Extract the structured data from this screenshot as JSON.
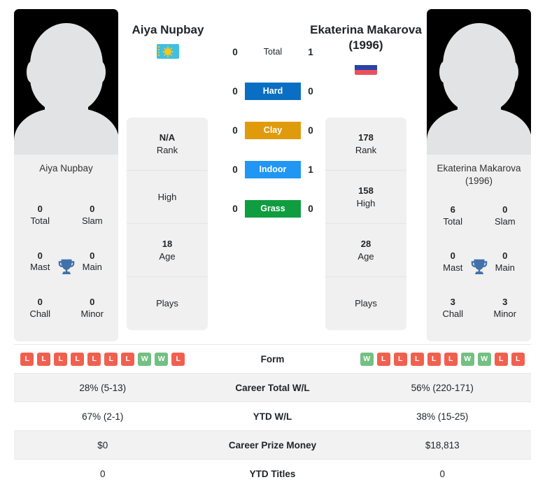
{
  "players": {
    "left": {
      "name": "Aiya Nupbay",
      "card_name": "Aiya Nupbay",
      "flag": "kazakhstan-flag",
      "trophies": [
        {
          "value": "0",
          "label": "Total"
        },
        {
          "value": "0",
          "label": "Slam"
        },
        {
          "value": "0",
          "label": "Mast"
        },
        {
          "value": "0",
          "label": "Main"
        },
        {
          "value": "0",
          "label": "Chall"
        },
        {
          "value": "0",
          "label": "Minor"
        }
      ],
      "info": [
        {
          "value": "N/A",
          "label": "Rank"
        },
        {
          "value": "",
          "label": "High"
        },
        {
          "value": "18",
          "label": "Age"
        },
        {
          "value": "",
          "label": "Plays"
        }
      ],
      "form": [
        "L",
        "L",
        "L",
        "L",
        "L",
        "L",
        "L",
        "W",
        "W",
        "L"
      ]
    },
    "right": {
      "name": "Ekaterina Makarova (1996)",
      "card_name_line1": "Ekaterina Makarova",
      "card_name_line2": "(1996)",
      "flag": "russia-flag",
      "trophies": [
        {
          "value": "6",
          "label": "Total"
        },
        {
          "value": "0",
          "label": "Slam"
        },
        {
          "value": "0",
          "label": "Mast"
        },
        {
          "value": "0",
          "label": "Main"
        },
        {
          "value": "3",
          "label": "Chall"
        },
        {
          "value": "3",
          "label": "Minor"
        }
      ],
      "info": [
        {
          "value": "178",
          "label": "Rank"
        },
        {
          "value": "158",
          "label": "High"
        },
        {
          "value": "28",
          "label": "Age"
        },
        {
          "value": "",
          "label": "Plays"
        }
      ],
      "form": [
        "W",
        "L",
        "L",
        "L",
        "L",
        "L",
        "W",
        "W",
        "L",
        "L"
      ]
    }
  },
  "h2h": [
    {
      "left": "0",
      "label": "Total",
      "right": "1",
      "color": "",
      "style": "plain"
    },
    {
      "left": "0",
      "label": "Hard",
      "right": "0",
      "color": "#0a6fc2",
      "style": "bar"
    },
    {
      "left": "0",
      "label": "Clay",
      "right": "0",
      "color": "#e09b0d",
      "style": "bar"
    },
    {
      "left": "0",
      "label": "Indoor",
      "right": "1",
      "color": "#2196f3",
      "style": "bar"
    },
    {
      "left": "0",
      "label": "Grass",
      "right": "0",
      "color": "#0f9d3f",
      "style": "bar"
    }
  ],
  "stats": [
    {
      "label": "Form",
      "left": "",
      "right": "",
      "type": "form",
      "shaded": false
    },
    {
      "label": "Career Total W/L",
      "left": "28% (5-13)",
      "right": "56% (220-171)",
      "type": "text",
      "shaded": true
    },
    {
      "label": "YTD W/L",
      "left": "67% (2-1)",
      "right": "38% (15-25)",
      "type": "text",
      "shaded": false
    },
    {
      "label": "Career Prize Money",
      "left": "$0",
      "right": "$18,813",
      "type": "text",
      "shaded": true
    },
    {
      "label": "YTD Titles",
      "left": "0",
      "right": "0",
      "type": "text",
      "shaded": false
    }
  ],
  "colors": {
    "win": "#73c082",
    "loss": "#f1604f",
    "trophy": "#4171ab",
    "card_bg": "#f0f0f0"
  }
}
